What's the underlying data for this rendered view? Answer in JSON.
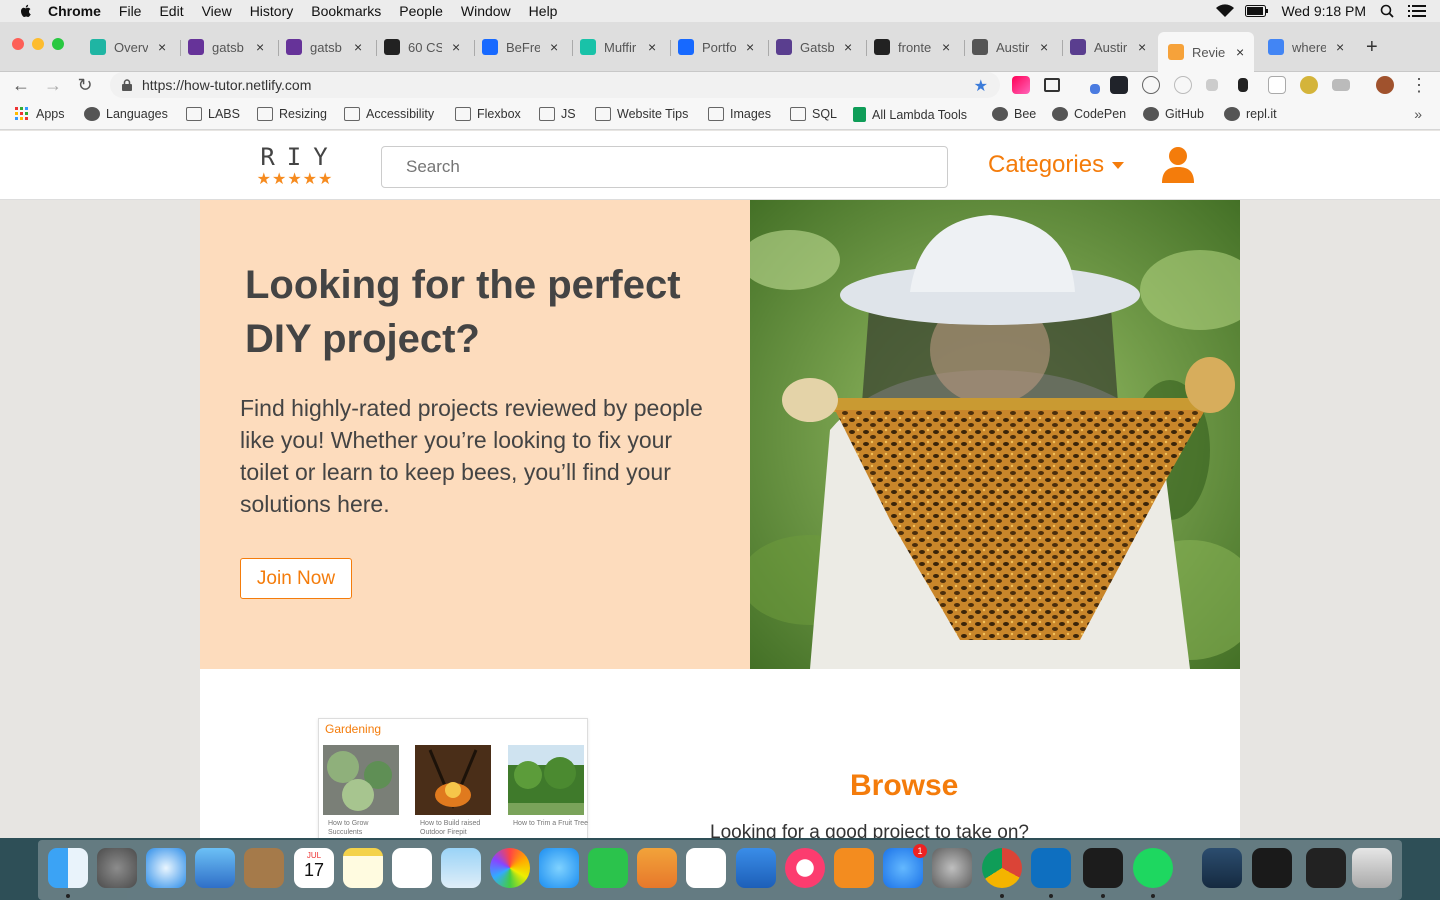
{
  "menubar": {
    "app": "Chrome",
    "items": [
      "File",
      "Edit",
      "View",
      "History",
      "Bookmarks",
      "People",
      "Window",
      "Help"
    ],
    "clock": "Wed 9:18 PM"
  },
  "tabs": [
    {
      "title": "Overv",
      "color": "#1fb5a3"
    },
    {
      "title": "gatsb",
      "color": "#663399"
    },
    {
      "title": "gatsb",
      "color": "#663399"
    },
    {
      "title": "60 CS",
      "color": "#222222"
    },
    {
      "title": "BeFre",
      "color": "#1769ff"
    },
    {
      "title": "Muffir",
      "color": "#19c2a8"
    },
    {
      "title": "Portfo",
      "color": "#1769ff"
    },
    {
      "title": "Gatsb",
      "color": "#5a3e8f"
    },
    {
      "title": "fronte",
      "color": "#222222"
    },
    {
      "title": "Austir",
      "color": "#555555"
    },
    {
      "title": "Austir",
      "color": "#5a3e8f"
    },
    {
      "title": "Revie",
      "color": "#f6a23a",
      "active": true
    },
    {
      "title": "where",
      "color": "#4285f4"
    }
  ],
  "address_bar": {
    "url": "https://how-tutor.netlify.com"
  },
  "bookmarks": [
    {
      "label": "Apps",
      "icon": "apps-grid-icon"
    },
    {
      "label": "Languages",
      "icon": "globe-icon"
    },
    {
      "label": "LABS",
      "icon": "folder-icon"
    },
    {
      "label": "Resizing",
      "icon": "folder-icon"
    },
    {
      "label": "Accessibility",
      "icon": "folder-icon"
    },
    {
      "label": "Flexbox",
      "icon": "folder-icon"
    },
    {
      "label": "JS",
      "icon": "folder-icon"
    },
    {
      "label": "Website Tips",
      "icon": "folder-icon"
    },
    {
      "label": "Images",
      "icon": "folder-icon"
    },
    {
      "label": "SQL",
      "icon": "folder-icon"
    },
    {
      "label": "All Lambda Tools",
      "icon": "sheets-icon"
    },
    {
      "label": "Bee",
      "icon": "globe-icon"
    },
    {
      "label": "CodePen",
      "icon": "codepen-icon"
    },
    {
      "label": "GitHub",
      "icon": "github-icon"
    },
    {
      "label": "repl.it",
      "icon": "replit-icon"
    }
  ],
  "site": {
    "logo_text": "RIY",
    "logo_stars": "★★★★★",
    "search_placeholder": "Search",
    "categories_label": "Categories",
    "hero_title": "Looking for the perfect DIY project?",
    "hero_text": "Find highly-rated projects reviewed by people like you! Whether you’re looking to fix your toilet or learn to keep bees, you’ll find your solutions here.",
    "join_label": "Join Now",
    "card_category": "Gardening",
    "card_items": [
      "How to Grow Succulents",
      "How to Build raised Outdoor Firepit",
      "How to Trim a Fruit Tree"
    ],
    "browse_title": "Browse",
    "browse_sub": "Looking for a good project to take on?"
  },
  "colors": {
    "accent": "#f47c0b",
    "hero_bg": "#fddcbd"
  },
  "dock": {
    "apps": [
      "finder",
      "launchpad",
      "safari",
      "mail",
      "contacts",
      "calendar",
      "notes",
      "reminders",
      "preview",
      "photos",
      "messages",
      "facetime",
      "pages",
      "numbers",
      "keynote",
      "itunes",
      "ibooks",
      "app-store",
      "system-preferences",
      "chrome",
      "vscode",
      "terminal",
      "spotify",
      "keyboard",
      "screenshots",
      "screen-capture",
      "trash"
    ],
    "calendar_month": "JUL",
    "calendar_day": "17",
    "app_store_badge": "1"
  }
}
